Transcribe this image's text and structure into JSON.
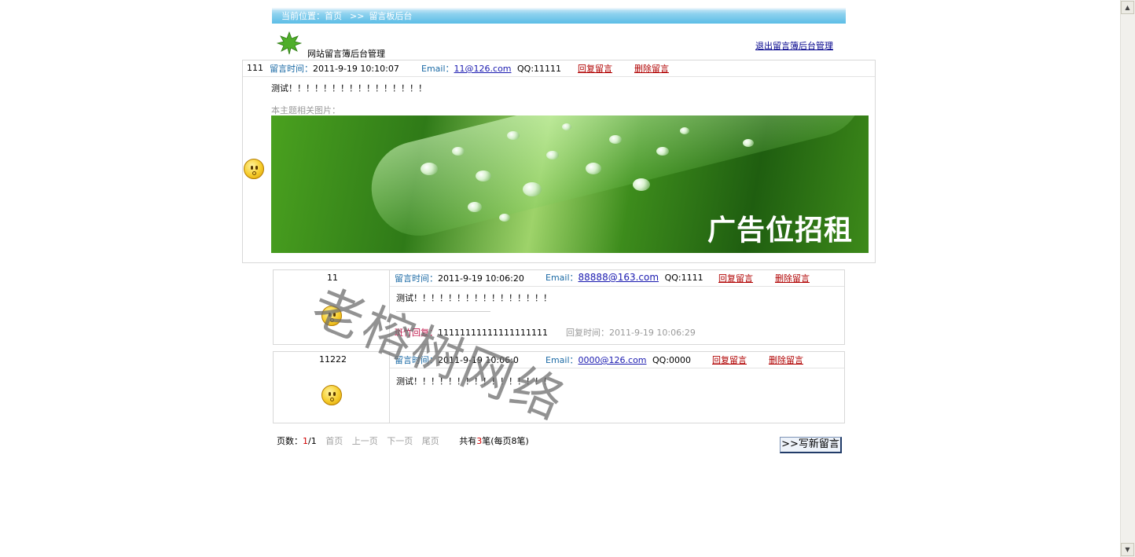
{
  "breadcrumb": {
    "prefix": "当前位置：",
    "home": "首页",
    "sep": ">>",
    "current": "留言板后台"
  },
  "header": {
    "title": "网站留言簿后台管理",
    "exit_link": "退出留言簿后台管理"
  },
  "labels": {
    "time": "留言时间：",
    "email": "Email：",
    "reply": "回复留言",
    "delete": "删除留言",
    "reply_time": "回复时间：",
    "related_img": "本主题相关图片：",
    "admin_reply": "斑竹回复："
  },
  "messages": [
    {
      "name": "111",
      "time": "2011-9-19 10:10:07",
      "email": "11@126.com",
      "qq": "QQ:11111",
      "content": "测试！！！！！！！！！！！！！！！！"
    },
    {
      "name": "11",
      "time": "2011-9-19 10:06:20",
      "email": "88888@163.com",
      "qq": "QQ:1111",
      "content": "测试！！！！！！！！！！！！！！！！",
      "reply": "11111111111111111111",
      "reply_time": "2011-9-19 10:06:29"
    },
    {
      "name": "11222",
      "time": "2011-9-19 10:06:0",
      "email": "0000@126.com",
      "qq": "QQ:0000",
      "content": "测试！！！！！！！！！！！！！！！！"
    }
  ],
  "banner": {
    "text": "广告位招租"
  },
  "watermark": "老榕树网络",
  "pager": {
    "label": "页数：",
    "current": "1",
    "total": "/1",
    "first": "首页",
    "prev": "上一页",
    "next": "下一页",
    "last": "尾页",
    "count_pre": "共有",
    "count": "3",
    "count_post": "笔(每页8笔)"
  },
  "write_button": ">>写新留言"
}
